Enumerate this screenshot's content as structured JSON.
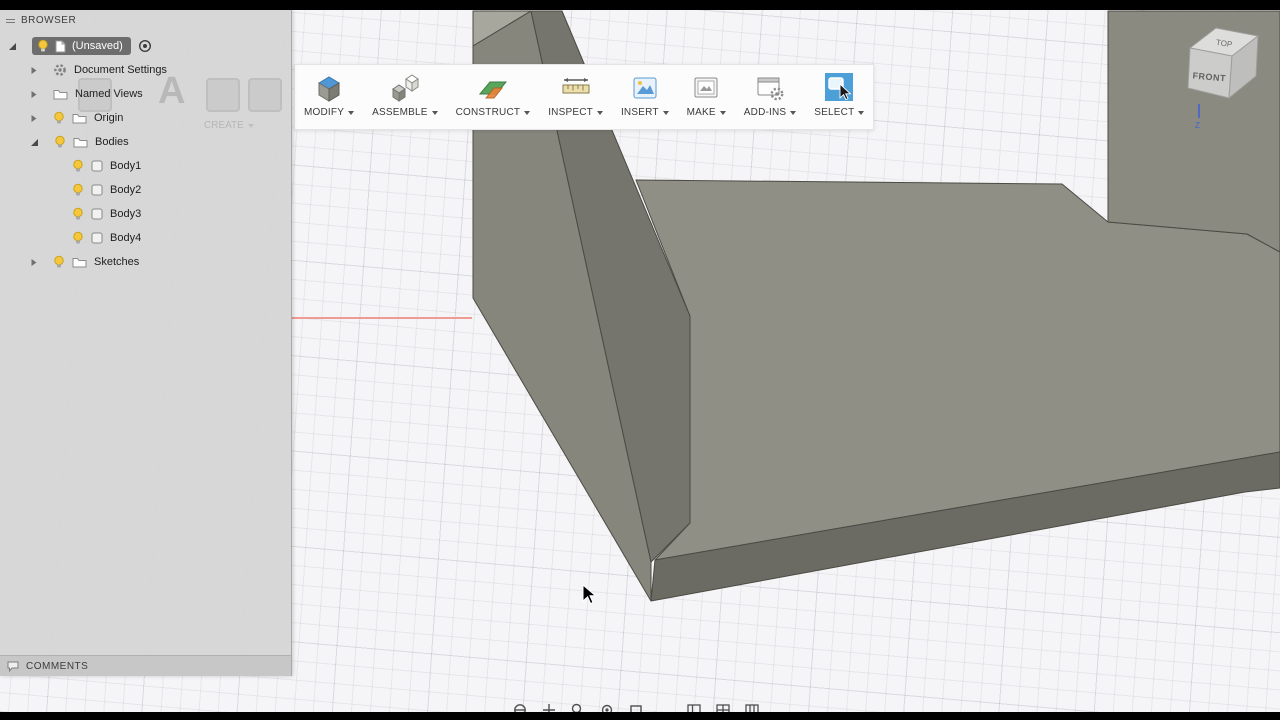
{
  "browser": {
    "title": "BROWSER",
    "root": {
      "label": "(Unsaved)"
    },
    "items": [
      {
        "label": "Document Settings"
      },
      {
        "label": "Named Views"
      },
      {
        "label": "Origin"
      },
      {
        "label": "Bodies"
      },
      {
        "label": "Sketches"
      }
    ],
    "bodies": [
      {
        "label": "Body1"
      },
      {
        "label": "Body2"
      },
      {
        "label": "Body3"
      },
      {
        "label": "Body4"
      }
    ],
    "comments": {
      "label": "COMMENTS"
    }
  },
  "ghost_toolbar": {
    "label": "CREATE",
    "glyph": "A"
  },
  "toolbar": {
    "items": [
      {
        "label": "MODIFY"
      },
      {
        "label": "ASSEMBLE"
      },
      {
        "label": "CONSTRUCT"
      },
      {
        "label": "INSPECT"
      },
      {
        "label": "INSERT"
      },
      {
        "label": "MAKE"
      },
      {
        "label": "ADD-INS"
      },
      {
        "label": "SELECT"
      }
    ]
  },
  "viewcube": {
    "top": "TOP",
    "front": "FRONT",
    "axis_z": "Z"
  },
  "colors": {
    "select_active": "#4d9fd8",
    "axis_red": "#ef9a93",
    "axis_blue": "#3a5fd9",
    "bulb": "#f4c83a",
    "model_face_light": "#a7a79d",
    "model_face_mid": "#86867d",
    "model_face_inner": "#75756d",
    "model_floor": "#8f8f86",
    "model_face_dark": "#6b6b63"
  }
}
